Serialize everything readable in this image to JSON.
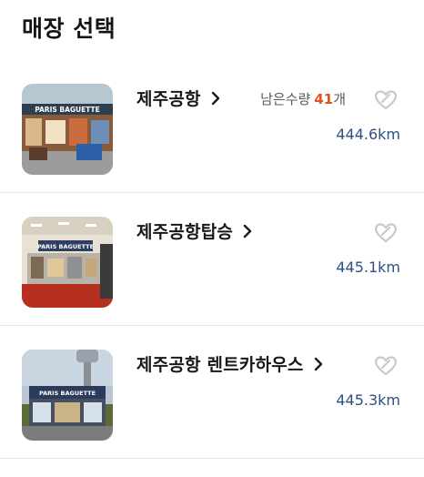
{
  "page": {
    "title": "매장 선택"
  },
  "stores": [
    {
      "name": "제주공항",
      "stock_label": "남은수량",
      "stock_count": "41",
      "stock_unit": "개",
      "distance": "444.6km",
      "image": "paris-baguette-store-interior",
      "sign_text": "PARIS BAGUETTE"
    },
    {
      "name": "제주공항탑승",
      "distance": "445.1km",
      "image": "paris-baguette-boarding-store",
      "sign_text": "PARIS BAGUETTE"
    },
    {
      "name": "제주공항 렌트카하우스",
      "distance": "445.3km",
      "image": "paris-baguette-rental-house",
      "sign_text": "PARIS BAGUETTE"
    }
  ],
  "colors": {
    "stock_count": "#e2531f",
    "distance": "#2c4f86",
    "fav_icon": "#c9c9c9",
    "divider": "#e6e6e6"
  }
}
